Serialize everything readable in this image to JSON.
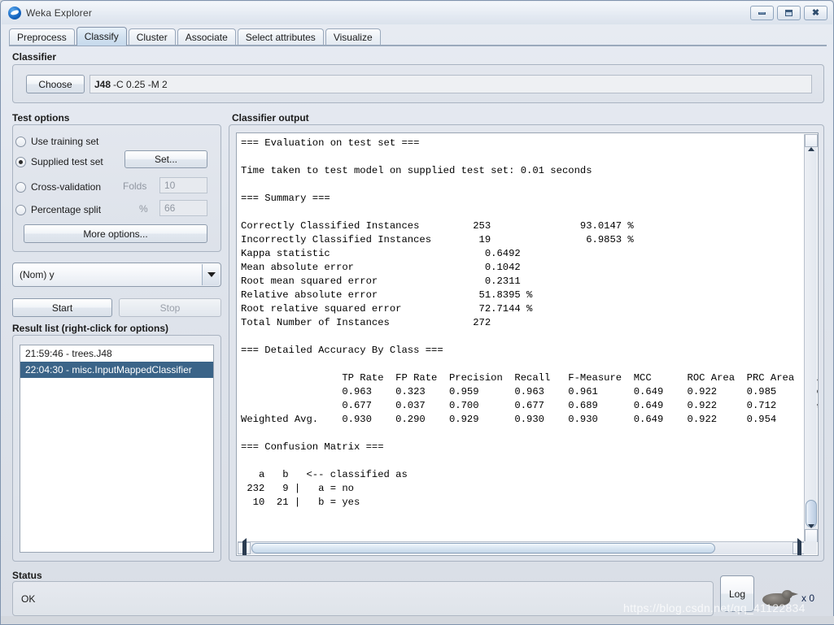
{
  "window": {
    "title": "Weka Explorer",
    "icon": "weka-bird-icon",
    "controls": {
      "minimize": "minimize",
      "maximize": "maximize",
      "close": "close"
    }
  },
  "tabs": [
    {
      "label": "Preprocess",
      "active": false
    },
    {
      "label": "Classify",
      "active": true
    },
    {
      "label": "Cluster",
      "active": false
    },
    {
      "label": "Associate",
      "active": false
    },
    {
      "label": "Select attributes",
      "active": false
    },
    {
      "label": "Visualize",
      "active": false
    }
  ],
  "classifier": {
    "group_label": "Classifier",
    "choose_label": "Choose",
    "name": "J48",
    "options": "-C 0.25 -M 2"
  },
  "test_options": {
    "group_label": "Test options",
    "items": [
      {
        "label": "Use training set",
        "selected": false
      },
      {
        "label": "Supplied test set",
        "selected": true
      },
      {
        "label": "Cross-validation",
        "selected": false
      },
      {
        "label": "Percentage split",
        "selected": false
      }
    ],
    "set_button": "Set...",
    "folds_label": "Folds",
    "folds_value": "10",
    "percent_label": "%",
    "percent_value": "66",
    "more_options_button": "More options..."
  },
  "class_combo": {
    "selected": "(Nom) y"
  },
  "actions": {
    "start": "Start",
    "stop": "Stop"
  },
  "result_list": {
    "group_label": "Result list (right-click for options)",
    "items": [
      {
        "label": "21:59:46 - trees.J48",
        "selected": false
      },
      {
        "label": "22:04:30 - misc.InputMappedClassifier",
        "selected": true
      }
    ]
  },
  "classifier_output": {
    "group_label": "Classifier output",
    "text": "=== Evaluation on test set ===\n\nTime taken to test model on supplied test set: 0.01 seconds\n\n=== Summary ===\n\nCorrectly Classified Instances         253               93.0147 %\nIncorrectly Classified Instances        19                6.9853 %\nKappa statistic                          0.6492\nMean absolute error                      0.1042\nRoot mean squared error                  0.2311\nRelative absolute error                 51.8395 %\nRoot relative squared error             72.7144 %\nTotal Number of Instances              272     \n\n=== Detailed Accuracy By Class ===\n\n                 TP Rate  FP Rate  Precision  Recall   F-Measure  MCC      ROC Area  PRC Area  Cla\n                 0.963    0.323    0.959      0.963    0.961      0.649    0.922     0.985     no\n                 0.677    0.037    0.700      0.677    0.689      0.649    0.922     0.712     yes\nWeighted Avg.    0.930    0.290    0.929      0.930    0.930      0.649    0.922     0.954     \n\n=== Confusion Matrix ===\n\n   a   b   <-- classified as\n 232   9 |   a = no\n  10  21 |   b = yes\n",
    "summary": {
      "evaluation_header": "=== Evaluation on test set ===",
      "time_taken": "Time taken to test model on supplied test set: 0.01 seconds",
      "summary_header": "=== Summary ===",
      "rows": [
        {
          "metric": "Correctly Classified Instances",
          "value": "253",
          "percent": "93.0147 %"
        },
        {
          "metric": "Incorrectly Classified Instances",
          "value": "19",
          "percent": "6.9853 %"
        },
        {
          "metric": "Kappa statistic",
          "value": "0.6492",
          "percent": ""
        },
        {
          "metric": "Mean absolute error",
          "value": "0.1042",
          "percent": ""
        },
        {
          "metric": "Root mean squared error",
          "value": "0.2311",
          "percent": ""
        },
        {
          "metric": "Relative absolute error",
          "value": "51.8395 %",
          "percent": ""
        },
        {
          "metric": "Root relative squared error",
          "value": "72.7144 %",
          "percent": ""
        },
        {
          "metric": "Total Number of Instances",
          "value": "272",
          "percent": ""
        }
      ]
    },
    "detailed_accuracy": {
      "header": "=== Detailed Accuracy By Class ===",
      "columns": [
        "TP Rate",
        "FP Rate",
        "Precision",
        "Recall",
        "F-Measure",
        "MCC",
        "ROC Area",
        "PRC Area",
        "Cla"
      ],
      "rows": [
        {
          "label": "",
          "values": [
            "0.963",
            "0.323",
            "0.959",
            "0.963",
            "0.961",
            "0.649",
            "0.922",
            "0.985"
          ],
          "class": "no"
        },
        {
          "label": "",
          "values": [
            "0.677",
            "0.037",
            "0.700",
            "0.677",
            "0.689",
            "0.649",
            "0.922",
            "0.712"
          ],
          "class": "yes"
        },
        {
          "label": "Weighted Avg.",
          "values": [
            "0.930",
            "0.290",
            "0.929",
            "0.930",
            "0.930",
            "0.649",
            "0.922",
            "0.954"
          ],
          "class": ""
        }
      ]
    },
    "confusion_matrix": {
      "header": "=== Confusion Matrix ===",
      "col_headers": [
        "a",
        "b"
      ],
      "legend": "<-- classified as",
      "rows": [
        {
          "counts": [
            "232",
            "9"
          ],
          "label": "a = no"
        },
        {
          "counts": [
            "10",
            "21"
          ],
          "label": "b = yes"
        }
      ]
    }
  },
  "status": {
    "group_label": "Status",
    "message": "OK",
    "log_button": "Log",
    "bird_count": "x 0"
  },
  "watermark": "https://blog.csdn.net/qq_41122834",
  "colors": {
    "accent_selection": "#3b6488",
    "active_tab": "#c6d9ec",
    "panel_bg": "#dfe4ec",
    "text": "#1b1b1b"
  }
}
